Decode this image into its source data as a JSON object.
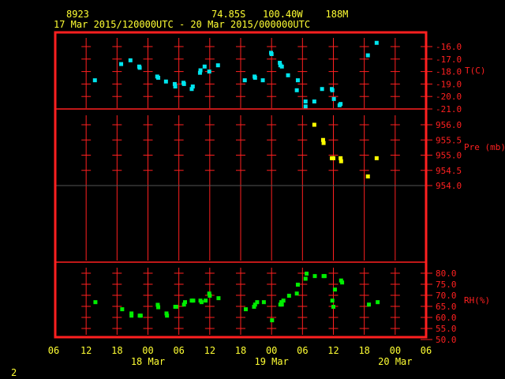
{
  "header": {
    "station": "8923",
    "location": "74.85S   100.40W    188M",
    "period": "17 Mar 2015/120000UTC - 20 Mar 2015/000000UTC"
  },
  "footer": {
    "page_number": "2"
  },
  "colors": {
    "frame": "#ff2020",
    "text": "#ffff33",
    "temperature": "#00e5ee",
    "pressure": "#ffff00",
    "humidity": "#00ee00",
    "divider_gray": "#555555"
  },
  "chart_data": {
    "type": "scatter",
    "x_unit": "hours since 17 Mar 2015 06 UTC",
    "xlim": [
      0,
      72
    ],
    "x_tick_labels": [
      "06",
      "12",
      "18",
      "00",
      "06",
      "12",
      "18",
      "00",
      "06",
      "12",
      "18",
      "00",
      "06"
    ],
    "date_labels": [
      {
        "label": "18 Mar",
        "hour": 18
      },
      {
        "label": "19 Mar",
        "hour": 42
      },
      {
        "label": "20 Mar",
        "hour": 66
      }
    ],
    "panels": [
      {
        "name": "temperature",
        "ylabel": "T(C)",
        "ylim": [
          -21.0,
          -16.0
        ],
        "tick_values": [
          -16,
          -17,
          -18,
          -19,
          -20,
          -21
        ],
        "tick_labels": [
          "-16.0",
          "-17.0",
          "-18.0",
          "-19.0",
          "-20.0",
          "-21.0"
        ],
        "points": [
          [
            7.7,
            -18.7
          ],
          [
            12.8,
            -17.4
          ],
          [
            14.6,
            -17.1
          ],
          [
            16.3,
            -17.6
          ],
          [
            16.4,
            -17.7
          ],
          [
            19.8,
            -18.4
          ],
          [
            20.0,
            -18.5
          ],
          [
            21.5,
            -18.8
          ],
          [
            23.2,
            -19.0
          ],
          [
            23.3,
            -19.2
          ],
          [
            24.9,
            -18.9
          ],
          [
            25.0,
            -19.0
          ],
          [
            26.5,
            -19.4
          ],
          [
            26.7,
            -19.2
          ],
          [
            28.1,
            -18.1
          ],
          [
            28.2,
            -17.9
          ],
          [
            29.0,
            -17.6
          ],
          [
            29.9,
            -18.0
          ],
          [
            31.6,
            -17.5
          ],
          [
            36.8,
            -18.7
          ],
          [
            38.7,
            -18.4
          ],
          [
            38.8,
            -18.5
          ],
          [
            40.3,
            -18.7
          ],
          [
            41.9,
            -16.5
          ],
          [
            42.0,
            -16.6
          ],
          [
            43.6,
            -17.3
          ],
          [
            43.7,
            -17.5
          ],
          [
            44.0,
            -17.6
          ],
          [
            45.2,
            -18.3
          ],
          [
            46.9,
            -19.5
          ],
          [
            47.1,
            -18.7
          ],
          [
            48.6,
            -20.8
          ],
          [
            48.6,
            -20.4
          ],
          [
            50.3,
            -20.4
          ],
          [
            51.8,
            -19.4
          ],
          [
            53.7,
            -19.4
          ],
          [
            53.8,
            -19.5
          ],
          [
            54.1,
            -20.2
          ],
          [
            55.2,
            -20.7
          ],
          [
            55.4,
            -20.6
          ],
          [
            60.7,
            -16.7
          ],
          [
            62.4,
            -15.7
          ]
        ]
      },
      {
        "name": "pressure",
        "ylabel": "Pre (mb)",
        "ylim": [
          953.0,
          956.5
        ],
        "tick_values": [
          956.0,
          955.5,
          955.0,
          954.5,
          954.0
        ],
        "tick_labels": [
          "956.0",
          "955.5",
          "955.0",
          "954.5",
          "954.0"
        ],
        "points": [
          [
            50.3,
            956.0
          ],
          [
            52.0,
            955.5
          ],
          [
            52.1,
            955.4
          ],
          [
            53.7,
            954.9
          ],
          [
            54.0,
            954.9
          ],
          [
            55.4,
            954.9
          ],
          [
            55.5,
            954.8
          ],
          [
            62.4,
            954.9
          ],
          [
            60.7,
            954.3
          ]
        ]
      },
      {
        "name": "humidity",
        "ylabel": "RH(%)",
        "ylim": [
          50.0,
          82.0
        ],
        "tick_values": [
          80,
          75,
          70,
          65,
          60,
          55,
          50
        ],
        "tick_labels": [
          "80.0",
          "75.0",
          "70.0",
          "65.0",
          "60.0",
          "55.0",
          "50.0"
        ],
        "points": [
          [
            7.8,
            66.9
          ],
          [
            13.0,
            63.7
          ],
          [
            14.8,
            61.8
          ],
          [
            14.8,
            60.8
          ],
          [
            16.4,
            60.8
          ],
          [
            16.6,
            60.8
          ],
          [
            19.9,
            65.7
          ],
          [
            20.0,
            64.6
          ],
          [
            21.6,
            61.8
          ],
          [
            21.7,
            60.8
          ],
          [
            23.3,
            64.8
          ],
          [
            23.5,
            64.8
          ],
          [
            25.0,
            65.8
          ],
          [
            25.2,
            66.9
          ],
          [
            26.5,
            67.6
          ],
          [
            26.8,
            67.6
          ],
          [
            28.2,
            67.6
          ],
          [
            28.4,
            66.9
          ],
          [
            29.2,
            67.6
          ],
          [
            29.9,
            70.8
          ],
          [
            30.0,
            69.8
          ],
          [
            31.7,
            68.7
          ],
          [
            37.0,
            63.7
          ],
          [
            38.6,
            64.8
          ],
          [
            38.8,
            65.8
          ],
          [
            39.2,
            66.9
          ],
          [
            40.5,
            66.9
          ],
          [
            42.1,
            58.7
          ],
          [
            43.7,
            65.8
          ],
          [
            43.9,
            66.9
          ],
          [
            44.0,
            65.8
          ],
          [
            44.3,
            67.6
          ],
          [
            45.4,
            69.8
          ],
          [
            46.9,
            70.8
          ],
          [
            47.1,
            74.8
          ],
          [
            48.6,
            77.5
          ],
          [
            48.8,
            79.8
          ],
          [
            50.4,
            78.7
          ],
          [
            52.1,
            78.7
          ],
          [
            52.3,
            78.7
          ],
          [
            53.8,
            67.6
          ],
          [
            54.0,
            64.8
          ],
          [
            54.3,
            72.6
          ],
          [
            55.5,
            76.7
          ],
          [
            55.7,
            75.8
          ],
          [
            60.9,
            65.8
          ],
          [
            62.6,
            66.9
          ]
        ]
      }
    ]
  }
}
